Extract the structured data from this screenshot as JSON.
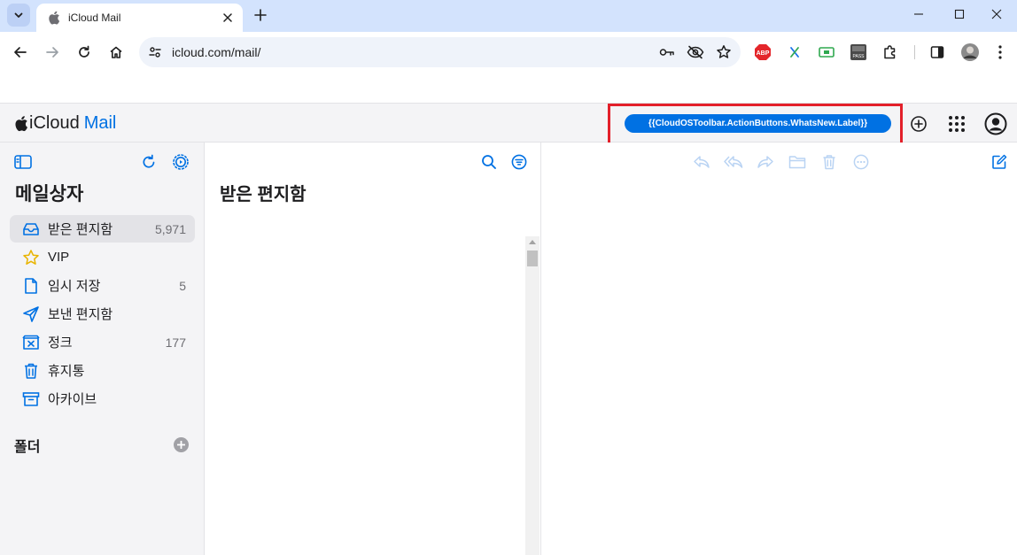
{
  "browser": {
    "tab_title": "iCloud Mail",
    "url": "icloud.com/mail/"
  },
  "app": {
    "brand_prefix": "iCloud",
    "brand_product": "Mail",
    "whats_new_label": "{{CloudOSToolbar.ActionButtons.WhatsNew.Label}}"
  },
  "sidebar": {
    "title": "메일상자",
    "mailboxes": [
      {
        "label": "받은 편지함",
        "count": "5,971",
        "icon": "inbox-icon",
        "active": true
      },
      {
        "label": "VIP",
        "count": "",
        "icon": "star-icon"
      },
      {
        "label": "임시 저장",
        "count": "5",
        "icon": "document-icon"
      },
      {
        "label": "보낸 편지함",
        "count": "",
        "icon": "paper-plane-icon"
      },
      {
        "label": "정크",
        "count": "177",
        "icon": "junk-icon"
      },
      {
        "label": "휴지통",
        "count": "",
        "icon": "trash-icon"
      },
      {
        "label": "아카이브",
        "count": "",
        "icon": "archive-icon"
      }
    ],
    "folders_title": "폴더"
  },
  "list": {
    "title": "받은 편지함"
  },
  "colors": {
    "accent": "#0071e3",
    "highlight": "#e3202a",
    "disabled_icon": "#b9d3f3"
  }
}
